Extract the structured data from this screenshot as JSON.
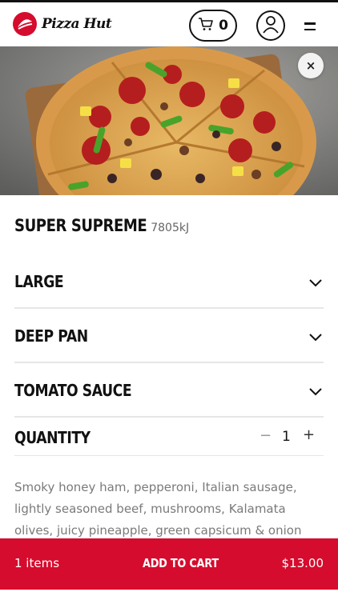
{
  "header": {
    "brand": "Pizza Hut",
    "cart_count": "0",
    "icons": {
      "logo": "pizza-hut-logo-icon",
      "cart": "shopping-cart-icon",
      "account": "user-account-icon",
      "menu": "hamburger-menu-icon",
      "close": "close-icon"
    }
  },
  "product": {
    "name": "SUPER SUPREME",
    "energy": "7805kJ",
    "close_label": "×",
    "options": [
      {
        "label": "LARGE"
      },
      {
        "label": "DEEP PAN"
      },
      {
        "label": "TOMATO SAUCE"
      }
    ],
    "quantity": {
      "label": "QUANTITY",
      "minus": "−",
      "value": "1",
      "plus": "+"
    },
    "description": "Smoky honey ham, pepperoni, Italian sausage, lightly seasoned beef, mushrooms, Kalamata olives, juicy pineapple, green capsicum & onion"
  },
  "footer": {
    "items": "1 items",
    "add_to_cart": "ADD TO CART",
    "price": "$13.00"
  },
  "colors": {
    "brand_red": "#d50c2d",
    "divider": "#e6e6e6",
    "muted_text": "#7a7a7a"
  }
}
